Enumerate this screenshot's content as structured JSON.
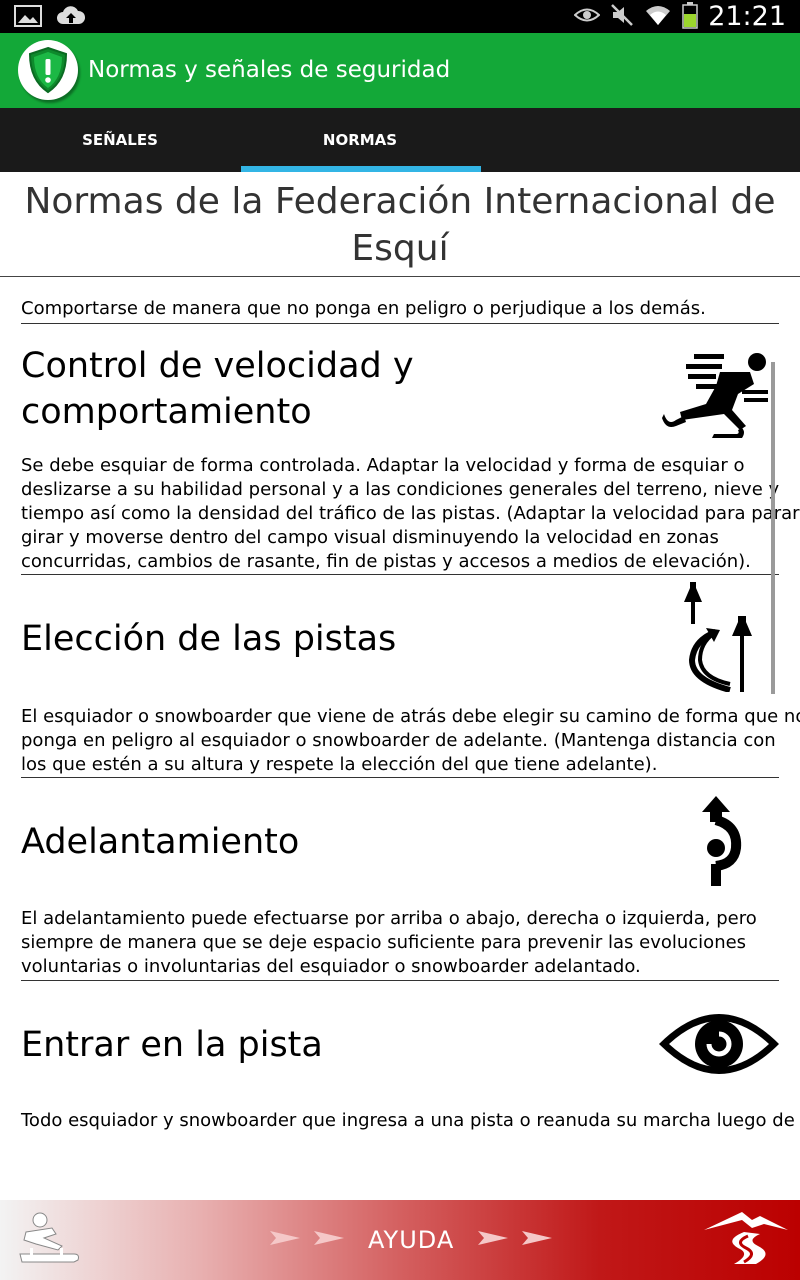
{
  "status_bar": {
    "time": "21:21",
    "icons": [
      "image-icon",
      "cloud-upload-icon",
      "eye-icon",
      "mute-icon",
      "wifi-icon",
      "battery-icon"
    ]
  },
  "app_bar": {
    "title": "Normas y señales de seguridad",
    "icon": "shield-icon",
    "color": "#13a838"
  },
  "tabs": [
    {
      "label": "SEÑALES",
      "active": false
    },
    {
      "label": "NORMAS",
      "active": true
    }
  ],
  "content": {
    "heading_line1": "Normas de la Federación Internacional de",
    "heading_line2": "Esquí",
    "intro": "Comportarse de manera que no ponga en peligro o perjudique a los demás.",
    "rules": [
      {
        "title_line1": "Control de velocidad y",
        "title_line2": "comportamiento",
        "icon": "speeding-skater-icon",
        "desc_lines": [
          "Se debe esquiar de forma controlada. Adaptar la velocidad y forma de esquiar o",
          "deslizarse a su habilidad personal y a las condiciones generales del terreno, nieve y",
          "tiempo así como la densidad del tráfico de las pistas. (Adaptar la velocidad para parar,",
          "girar y moverse dentro del campo visual disminuyendo la velocidad en zonas",
          "concurridas, cambios de rasante, fin de pistas y accesos a medios de elevación)."
        ]
      },
      {
        "title_line1": "Elección de las pistas",
        "icon": "path-choice-icon",
        "desc_lines": [
          "El esquiador o snowboarder que viene de atrás debe elegir su camino de forma que no",
          "ponga en peligro al esquiador o snowboarder de adelante. (Mantenga distancia con",
          "los que estén a su altura y respete la elección del que tiene adelante)."
        ]
      },
      {
        "title_line1": "Adelantamiento",
        "icon": "overtaking-icon",
        "desc_lines": [
          "El adelantamiento puede efectuarse por arriba o abajo, derecha o izquierda, pero",
          "siempre de manera que se deje espacio suficiente para prevenir las evoluciones",
          "voluntarias o involuntarias del esquiador o snowboarder adelantado."
        ]
      },
      {
        "title_line1": "Entrar en la pista",
        "icon": "eye-icon",
        "desc_lines": [
          "Todo esquiador y snowboarder que ingresa a una pista o reanuda su marcha luego de"
        ]
      }
    ]
  },
  "bottom_bar": {
    "label": "AYUDA",
    "left_icon": "sledder-icon",
    "right_icon": "mountain-slope-icon"
  }
}
